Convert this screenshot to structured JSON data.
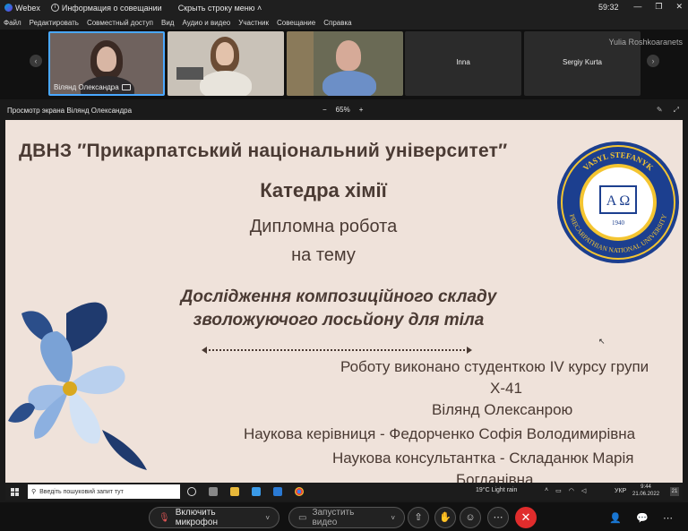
{
  "titlebar": {
    "app_name": "Webex",
    "meeting_info": "Информация о совещании",
    "hide_menu": "Скрыть строку меню",
    "clock": "59:32"
  },
  "menu": [
    "Файл",
    "Редактировать",
    "Совместный доступ",
    "Вид",
    "Аудио и видео",
    "Участник",
    "Совещание",
    "Справка"
  ],
  "participants": {
    "tiles": [
      {
        "name": "Вілянд Олександра",
        "video": true
      },
      {
        "name": "",
        "video": true
      },
      {
        "name": "",
        "video": true
      },
      {
        "name": "Inna",
        "video": false
      },
      {
        "name": "Sergiy Kurta",
        "video": false
      }
    ],
    "extra_name": "Yulia Roshkoaranets"
  },
  "share_bar": {
    "title": "Просмотр экрана Вілянд Олександра",
    "zoom_minus": "−",
    "zoom": "65%",
    "zoom_plus": "+"
  },
  "slide": {
    "university": "ДВНЗ ″Прикарпатський національний університет″",
    "department": "Катедра хімії",
    "diploma": "Дипломна робота",
    "on_theme": "на тему",
    "topic_line1": "Дослідження композиційного складу",
    "topic_line2": "зволожуючого лосьйону для тіла",
    "done_by": "Роботу виконано студенткою IV курсу групи",
    "group": "Х-41",
    "student": "Вілянд Олексанрою",
    "supervisor": "Наукова керівниця - Федорченко Софія Володимирівна",
    "consultant": "Наукова консультантка - Складанюк Марія",
    "consultant_patronymic": "Богданівна",
    "seal": {
      "top_text": "VASYL STEFANYK",
      "bottom_text": "PRECARPATHIAN NATIONAL UNIVERSITY",
      "letters": "A  Ω",
      "year": "1940"
    }
  },
  "taskbar": {
    "search_placeholder": "Введіть пошуковий запит тут",
    "weather": "19°C  Light rain",
    "lang": "УКР",
    "time": "9:44",
    "date": "21.06.2022",
    "notifications": "21"
  },
  "controls": {
    "mic": "Включить микрофон",
    "video": "Запустить видео"
  },
  "colors": {
    "slide_bg": "#efe2da",
    "slide_text": "#4a3a33",
    "end_button": "#e02c2c",
    "active_tile_border": "#4aa8ff"
  }
}
